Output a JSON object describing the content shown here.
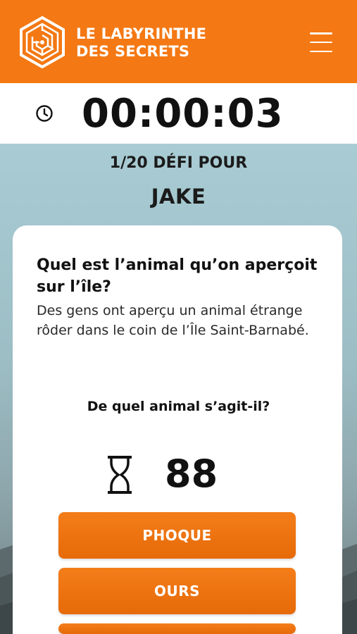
{
  "header": {
    "logo_line1": "LE LABYRINTHE",
    "logo_line2": "DES SECRETS",
    "brand_color": "#f47813"
  },
  "timer": {
    "value": "00:00:03"
  },
  "challenge": {
    "label": "1/20 DÉFI POUR",
    "player": "JAKE"
  },
  "question": {
    "title": "Quel est l’animal qu’on aperçoit sur l’île?",
    "description": "Des gens ont aperçu un animal étrange rôder dans le coin de l’Île Saint-Barnabé.",
    "prompt": "De quel animal s’agit-il?",
    "countdown": "88"
  },
  "answers": [
    {
      "label": "PHOQUE"
    },
    {
      "label": "OURS"
    },
    {
      "label": ""
    }
  ]
}
